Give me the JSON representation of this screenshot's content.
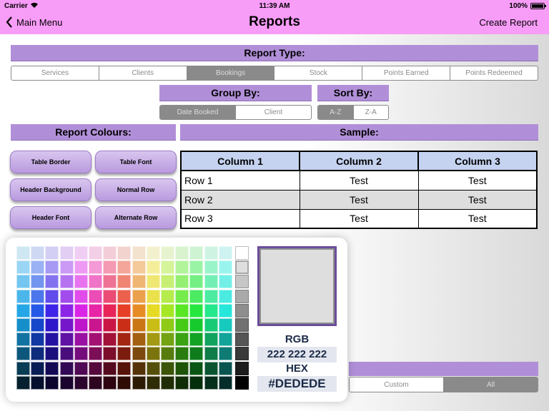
{
  "status_bar": {
    "carrier": "Carrier",
    "time": "11:39 AM",
    "battery": "100%"
  },
  "nav": {
    "back_label": "Main Menu",
    "title": "Reports",
    "action_label": "Create Report"
  },
  "report_type": {
    "header": "Report Type:",
    "options": [
      "Services",
      "Clients",
      "Bookings",
      "Stock",
      "Points Earned",
      "Points Redeemed"
    ],
    "selected_index": 2
  },
  "group_by": {
    "header": "Group By:",
    "options": [
      "Date Booked",
      "Client"
    ],
    "selected_index": 0
  },
  "sort_by": {
    "header": "Sort By:",
    "options": [
      "A-Z",
      "Z-A"
    ],
    "selected_index": 0
  },
  "report_colours": {
    "header": "Report Colours:",
    "buttons": [
      "Table Border",
      "Table Font",
      "Header Background",
      "Normal Row",
      "Header Font",
      "Alternate Row"
    ]
  },
  "sample": {
    "header": "Sample:",
    "columns": [
      "Column 1",
      "Column 2",
      "Column 3"
    ],
    "rows": [
      [
        "Row 1",
        "Test",
        "Test"
      ],
      [
        "Row 2",
        "Test",
        "Test"
      ],
      [
        "Row 3",
        "Test",
        "Test"
      ]
    ]
  },
  "color_picker": {
    "rgb_label": "RGB",
    "rgb_value": "222 222 222",
    "hex_label": "HEX",
    "hex_value": "#DEDEDE",
    "preview_color": "#dedede"
  },
  "date_range": {
    "options": [
      "Custom",
      "All"
    ],
    "selected_index": 1
  },
  "colors": {
    "bar": "#f79cf7",
    "header": "#b18fd8",
    "button": "#c8aee8",
    "table_header": "#c5d3f0",
    "alt_row": "#dedede"
  }
}
